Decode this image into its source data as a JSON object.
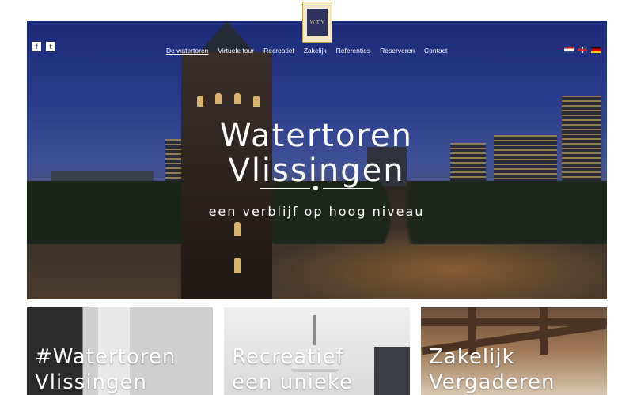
{
  "brand": {
    "logo_text": "W T V"
  },
  "social": [
    {
      "name": "facebook",
      "glyph": "f"
    },
    {
      "name": "twitter",
      "glyph": "t"
    }
  ],
  "nav": {
    "items": [
      {
        "label": "De watertoren",
        "active": true
      },
      {
        "label": "Virtuele tour"
      },
      {
        "label": "Recreatief"
      },
      {
        "label": "Zakelijk"
      },
      {
        "label": "Referenties"
      },
      {
        "label": "Reserveren"
      },
      {
        "label": "Contact"
      }
    ]
  },
  "languages": [
    "nl",
    "en",
    "de"
  ],
  "hero": {
    "title_line1": "Watertoren",
    "title_line2": "Vlissingen",
    "tagline": "een verblijf op hoog niveau"
  },
  "cards": [
    {
      "title": "#Watertoren",
      "subtitle": "Vlissingen"
    },
    {
      "title": "Recreatief",
      "subtitle": "een unieke"
    },
    {
      "title": "Zakelijk",
      "subtitle": "Vergaderen"
    }
  ],
  "colors": {
    "accent": "#2c3160",
    "sky": "#2a3c8c",
    "text_on_image": "#ffffff"
  }
}
